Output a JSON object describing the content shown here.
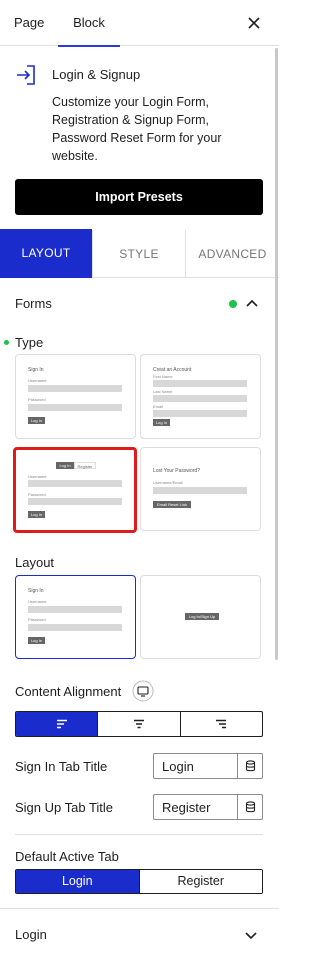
{
  "topbar": {
    "tabs": [
      "Page",
      "Block"
    ],
    "close_icon": "close-icon"
  },
  "block": {
    "icon": "login-arrow-icon",
    "title": "Login & Signup",
    "description": "Customize your Login Form, Registration & Signup Form, Password Reset Form for your website.",
    "import_button": "Import Presets"
  },
  "settings_tabs": [
    "LAYOUT",
    "STYLE",
    "ADVANCED"
  ],
  "forms_section": {
    "label": "Forms",
    "status_dot": "#1ec24a"
  },
  "type_field": {
    "label": "Type",
    "presets": {
      "signin": {
        "title": "Sign In",
        "username": "Username",
        "password": "Password",
        "button": "Log In"
      },
      "create": {
        "title": "Creat an Account",
        "first": "First Name",
        "last": "Last Name",
        "email": "Email",
        "button": "Log In"
      },
      "tabbed": {
        "tab_login": "Log In",
        "tab_register": "Register",
        "username": "Username",
        "password": "Password",
        "button": "Log In"
      },
      "lost": {
        "title": "Lost Your Password?",
        "label": "Username/Email",
        "button": "Email Reset Link"
      }
    }
  },
  "layout_field": {
    "label": "Layout",
    "option1": {
      "title": "Sign In",
      "username": "Username",
      "password": "Password",
      "button": "Log In"
    },
    "option2": {
      "button": "Log In/Sign Up"
    }
  },
  "content_alignment": {
    "label": "Content Alignment",
    "device_icon": "desktop-icon",
    "options": [
      "align-left-icon",
      "align-center-icon",
      "align-right-icon"
    ],
    "selected": "align-left-icon"
  },
  "signin_tab_title": {
    "label": "Sign In Tab Title",
    "value": "Login"
  },
  "signup_tab_title": {
    "label": "Sign Up Tab Title",
    "value": "Register"
  },
  "default_active_tab": {
    "label": "Default Active Tab",
    "options": [
      "Login",
      "Register"
    ],
    "selected": "Login"
  },
  "login_section": {
    "label": "Login"
  },
  "colors": {
    "accent": "#1a2dcc",
    "highlight": "#e01b1b"
  }
}
